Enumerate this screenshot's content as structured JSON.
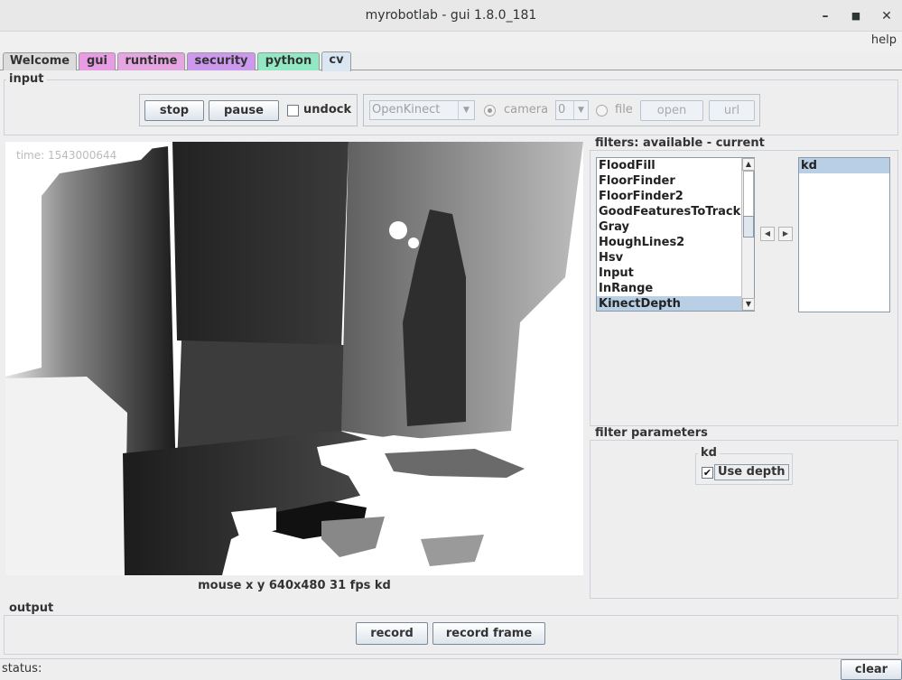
{
  "window": {
    "title": "myrobotlab - gui 1.8.0_181",
    "minimize_glyph": "–",
    "maximize_glyph": "■",
    "close_glyph": "✕"
  },
  "menubar": {
    "help": "help"
  },
  "tabs": [
    {
      "label": "Welcome",
      "color": "#dcdcdc",
      "active": false
    },
    {
      "label": "gui",
      "color": "#e79ce3",
      "active": false
    },
    {
      "label": "runtime",
      "color": "#e5a6e1",
      "active": false
    },
    {
      "label": "security",
      "color": "#cc99ee",
      "active": false
    },
    {
      "label": "python",
      "color": "#93e8c4",
      "active": false
    },
    {
      "label": "cv",
      "color": "#dbe6f3",
      "active": true
    }
  ],
  "input": {
    "title": "input",
    "stop_label": "stop",
    "pause_label": "pause",
    "undock_label": "undock",
    "undock_checked": false,
    "grabber": "OpenKinect",
    "camera_label": "camera",
    "camera_selected": true,
    "camera_index": "0",
    "file_label": "file",
    "file_selected": false,
    "open_label": "open",
    "url_label": "url"
  },
  "video": {
    "overlay_text": "time:  1543000644",
    "status": "mouse x y  640x480 31 fps kd"
  },
  "filters": {
    "title": "filters: available - current",
    "available": [
      "FloodFill",
      "FloorFinder",
      "FloorFinder2",
      "GoodFeaturesToTrack",
      "Gray",
      "HoughLines2",
      "Hsv",
      "Input",
      "InRange",
      "KinectDepth"
    ],
    "available_selected": "KinectDepth",
    "current": [
      "kd"
    ],
    "current_selected": "kd",
    "move_left_glyph": "◀",
    "move_right_glyph": "▶"
  },
  "filter_parameters": {
    "title": "filter parameters",
    "filter_name": "kd",
    "use_depth_label": "Use depth",
    "use_depth_checked": true
  },
  "output": {
    "title": "output",
    "record_label": "record",
    "record_frame_label": "record frame"
  },
  "statusbar": {
    "status_label": "status:",
    "clear_label": "clear"
  }
}
